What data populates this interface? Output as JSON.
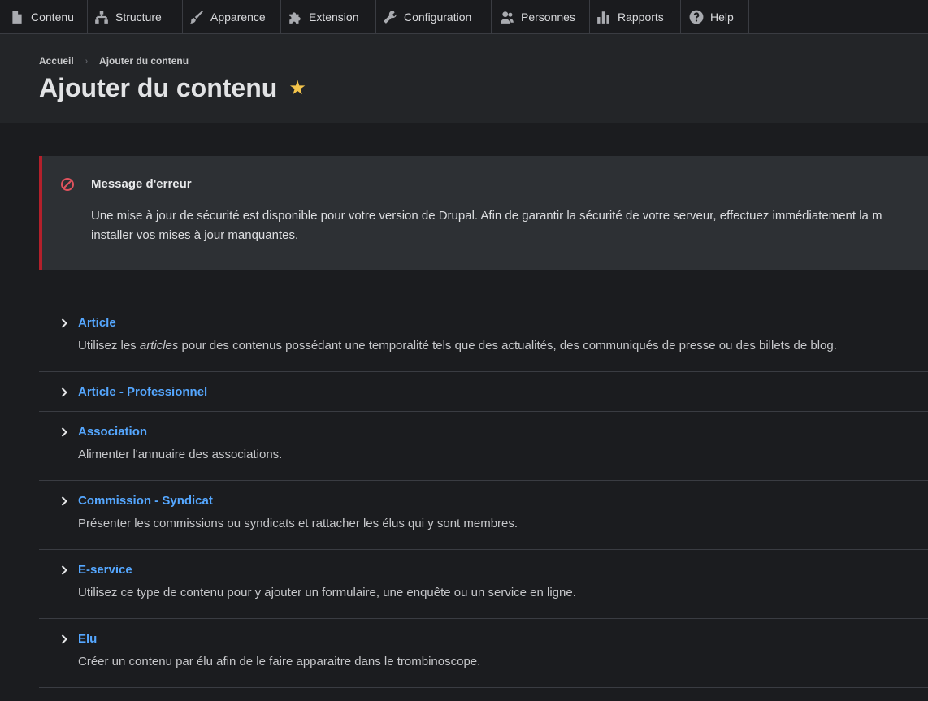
{
  "toolbar": {
    "items": [
      {
        "label": "Contenu",
        "icon": "file-icon"
      },
      {
        "label": "Structure",
        "icon": "sitemap-icon"
      },
      {
        "label": "Apparence",
        "icon": "paintbrush-icon"
      },
      {
        "label": "Extension",
        "icon": "puzzle-icon"
      },
      {
        "label": "Configuration",
        "icon": "wrench-icon"
      },
      {
        "label": "Personnes",
        "icon": "people-icon"
      },
      {
        "label": "Rapports",
        "icon": "bar-chart-icon"
      },
      {
        "label": "Help",
        "icon": "help-icon"
      }
    ]
  },
  "breadcrumb": {
    "home": "Accueil",
    "current": "Ajouter du contenu"
  },
  "page": {
    "title": "Ajouter du contenu",
    "star": "★"
  },
  "message": {
    "title": "Message d'erreur",
    "body_line1": "Une mise à jour de sécurité est disponible pour votre version de Drupal. Afin de garantir la sécurité de votre serveur, effectuez immédiatement la m",
    "body_line2": "installer vos mises à jour manquantes.",
    "accent": "#b3202b"
  },
  "content_types": [
    {
      "label": "Article",
      "desc_pre": "Utilisez les ",
      "desc_em": "articles",
      "desc_post": " pour des contenus possédant une temporalité tels que des actualités, des communiqués de presse ou des billets de blog."
    },
    {
      "label": "Article - Professionnel"
    },
    {
      "label": "Association",
      "desc": "Alimenter l'annuaire des associations."
    },
    {
      "label": "Commission - Syndicat",
      "desc": "Présenter les commissions ou syndicats et rattacher les élus qui y sont membres."
    },
    {
      "label": "E-service",
      "desc": "Utilisez ce type de contenu pour y ajouter un formulaire, une enquête ou un service en ligne."
    },
    {
      "label": "Elu",
      "desc": "Créer un contenu par élu afin de le faire apparaitre dans le trombinoscope."
    }
  ],
  "colors": {
    "link": "#55a7ff",
    "star": "#f3c44b"
  }
}
